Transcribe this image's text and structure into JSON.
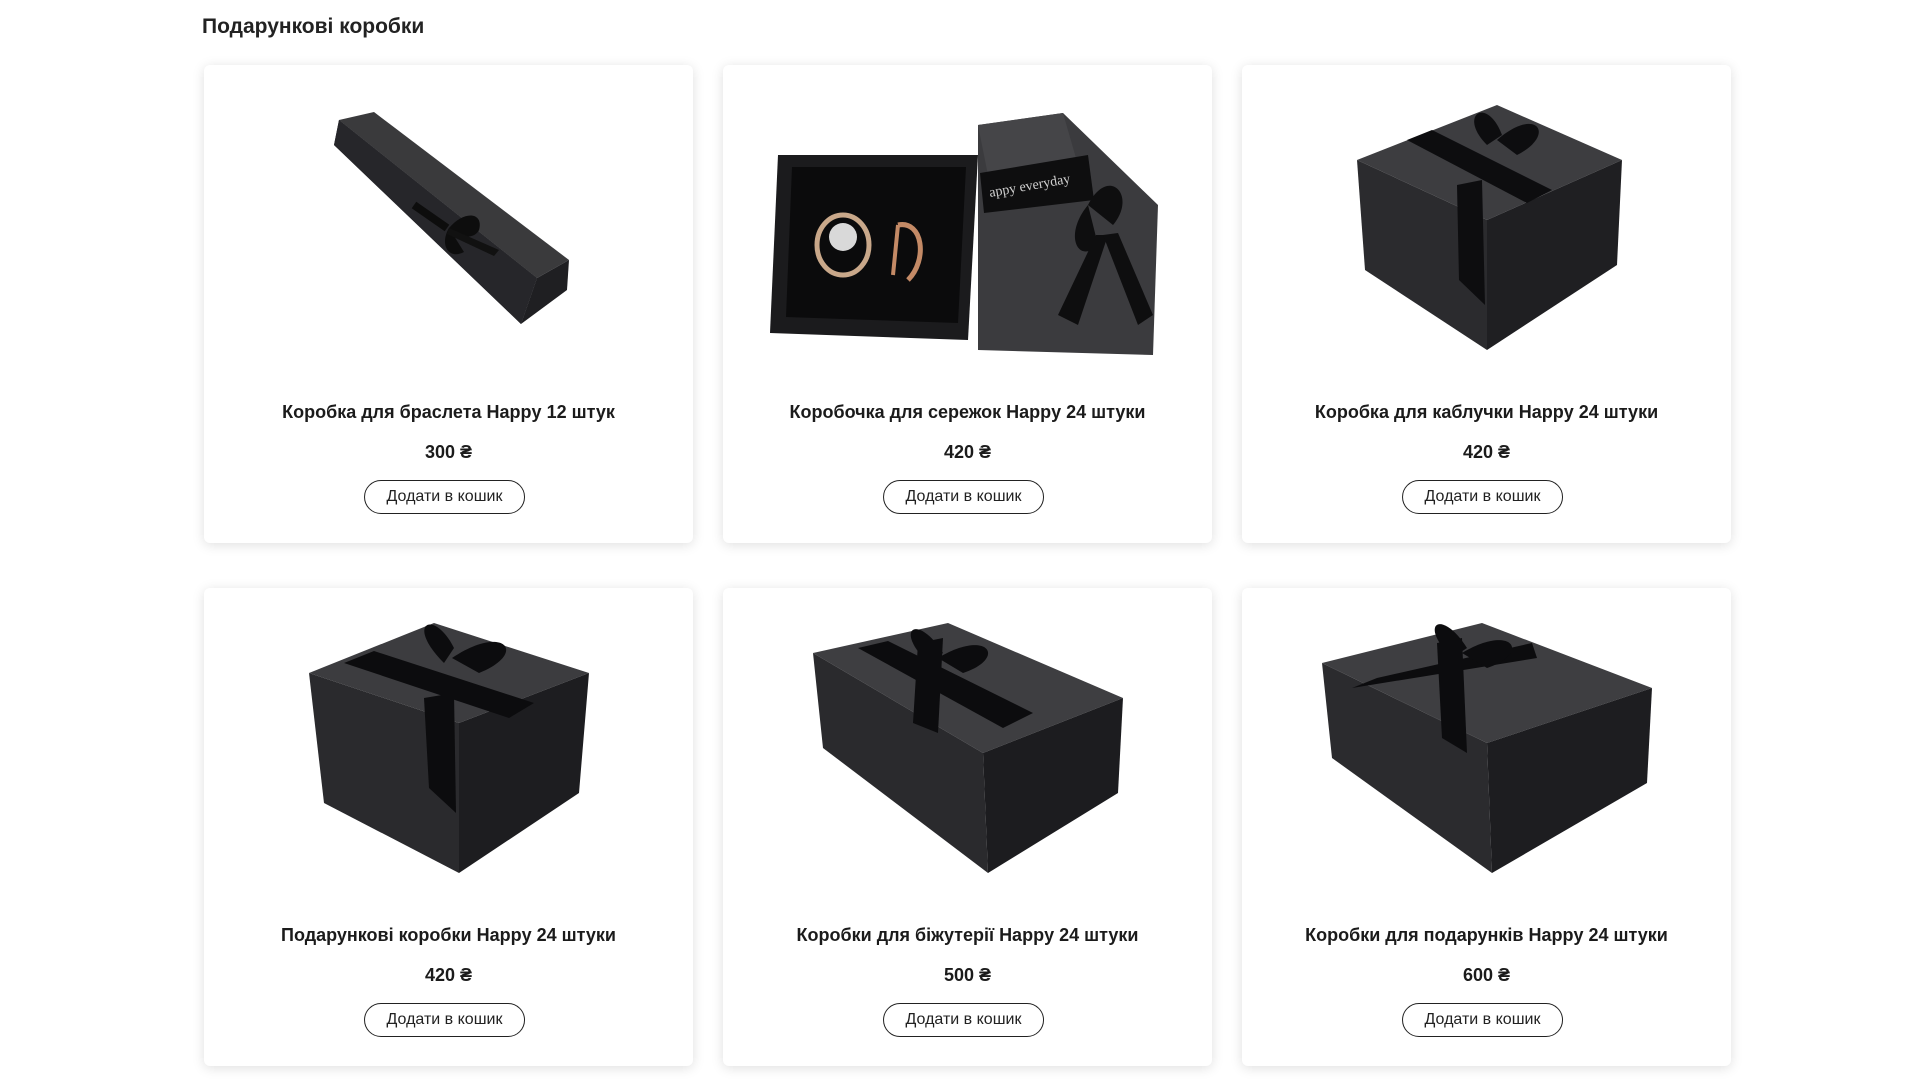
{
  "section": {
    "title": "Подарункові коробки"
  },
  "products": [
    {
      "title_pre": "Коробка для браслета ",
      "title_brand": "Happy",
      "title_post": " 12 штук",
      "price": "300 ₴",
      "button_label": "Додати в кошик",
      "image_icon": "bracelet-box-image"
    },
    {
      "title_pre": "Коробочка для сережок ",
      "title_brand": "Happy",
      "title_post": " 24 штуки",
      "price": "420 ₴",
      "button_label": "Додати в кошик",
      "image_icon": "earring-box-image"
    },
    {
      "title_pre": "Коробка для каблучки ",
      "title_brand": "Happy",
      "title_post": " 24 штуки",
      "price": "420 ₴",
      "button_label": "Додати в кошик",
      "image_icon": "ring-box-image"
    },
    {
      "title_pre": "Подарункові коробки ",
      "title_brand": "Happy",
      "title_post": " 24 штуки",
      "price": "420 ₴",
      "button_label": "Додати в кошик",
      "image_icon": "gift-box-image"
    },
    {
      "title_pre": "Коробки для біжутерії ",
      "title_brand": "Happy",
      "title_post": " 24 штуки",
      "price": "500 ₴",
      "button_label": "Додати в кошик",
      "image_icon": "jewelry-box-image"
    },
    {
      "title_pre": "Коробки для подарунків ",
      "title_brand": "Happy",
      "title_post": " 24 штуки",
      "price": "600 ₴",
      "button_label": "Додати в кошик",
      "image_icon": "present-box-image"
    }
  ],
  "ribbon_text": "Happy everyday",
  "colors": {
    "box_dark": "#2a2a2a",
    "box_mid": "#3a3a3a",
    "box_light": "#4a4a4a",
    "ribbon": "#111111",
    "card_bg": "#ffffff"
  }
}
